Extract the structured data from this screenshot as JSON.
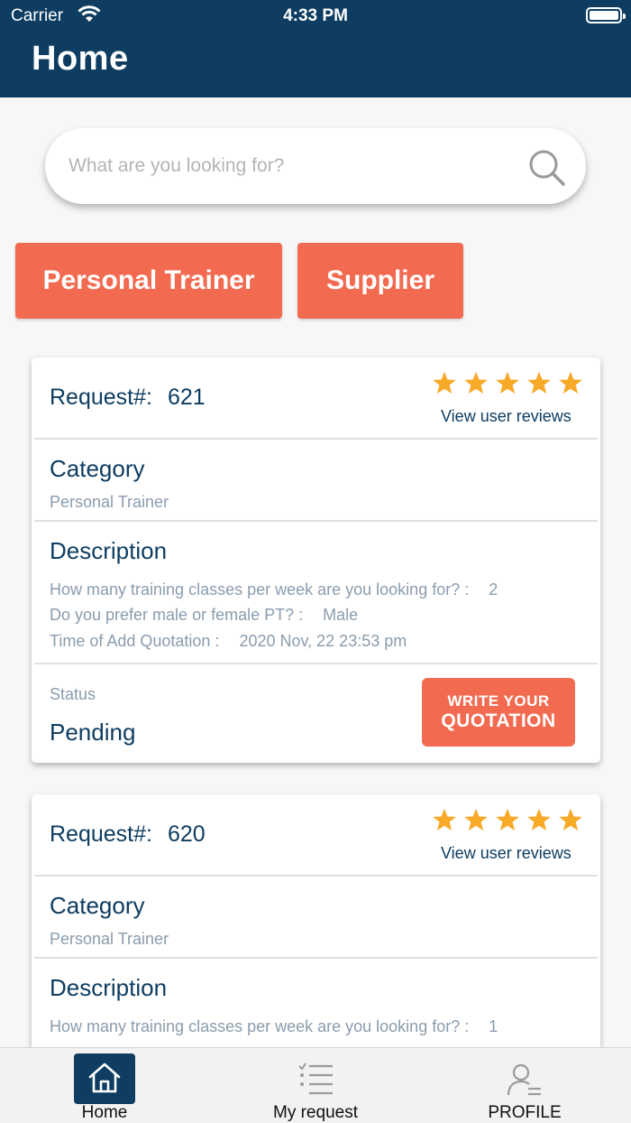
{
  "status_bar": {
    "carrier": "Carrier",
    "time": "4:33 PM"
  },
  "header": {
    "title": "Home"
  },
  "search": {
    "placeholder": "What are you looking for?"
  },
  "categories": [
    {
      "label": "Personal Trainer"
    },
    {
      "label": "Supplier"
    }
  ],
  "requests": [
    {
      "request_label": "Request#:",
      "request_number": "621",
      "rating_stars": 5,
      "reviews_link": "View user reviews",
      "category_title": "Category",
      "category_value": "Personal Trainer",
      "description_title": "Description",
      "details": [
        {
          "question": "How many training classes per week are you looking for? :",
          "answer": "2"
        },
        {
          "question": "Do you prefer male or female PT? :",
          "answer": "Male"
        },
        {
          "question": "Time of Add Quotation :",
          "answer": "2020 Nov, 22 23:53 pm"
        }
      ],
      "status_label": "Status",
      "status_value": "Pending",
      "quote_button_line1": "WRITE YOUR",
      "quote_button_line2": "QUOTATION"
    },
    {
      "request_label": "Request#:",
      "request_number": "620",
      "rating_stars": 5,
      "reviews_link": "View user reviews",
      "category_title": "Category",
      "category_value": "Personal Trainer",
      "description_title": "Description",
      "details": [
        {
          "question": "How many training classes per week are you looking for? :",
          "answer": "1"
        }
      ]
    }
  ],
  "tabs": [
    {
      "label": "Home",
      "icon": "home-icon",
      "active": true
    },
    {
      "label": "My request",
      "icon": "list-icon",
      "active": false
    },
    {
      "label": "PROFILE",
      "icon": "profile-icon",
      "active": false
    }
  ],
  "colors": {
    "header": "#0e3d61",
    "accent": "#f26b51",
    "star": "#f7a928",
    "muted_text": "#8a9cae"
  }
}
